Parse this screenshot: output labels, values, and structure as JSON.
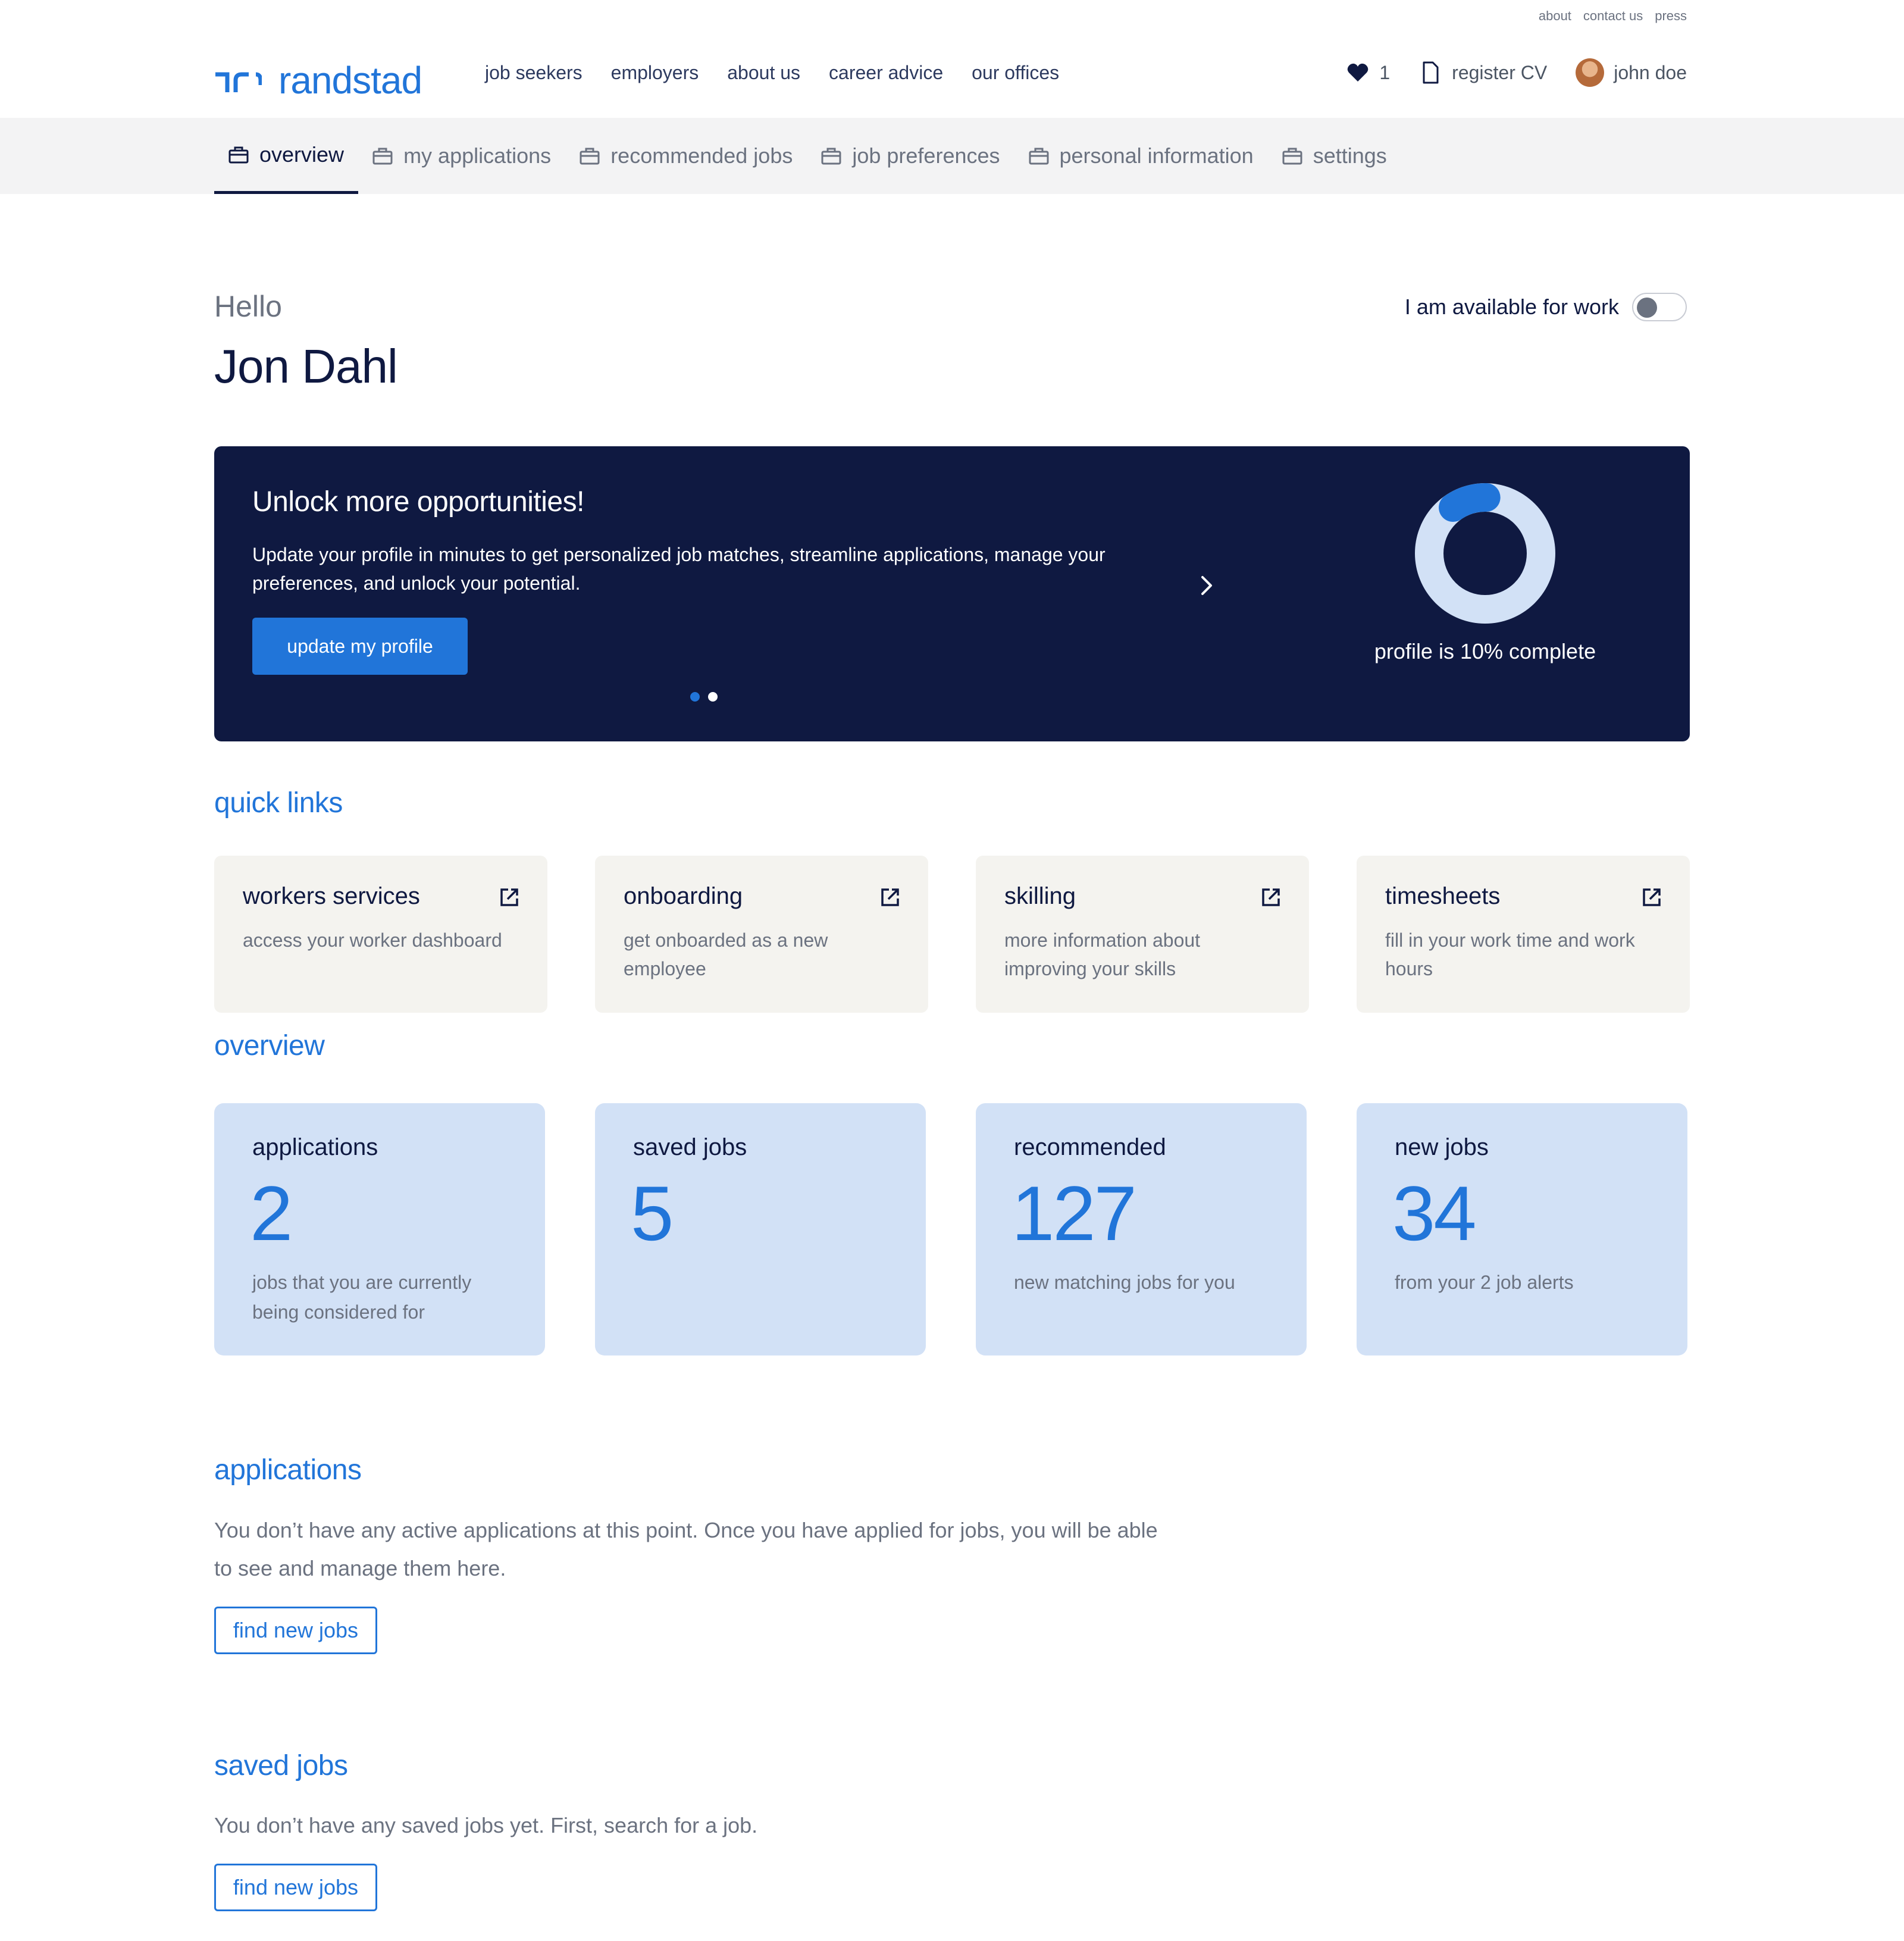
{
  "util_links": [
    "about",
    "contact us",
    "press"
  ],
  "header": {
    "logo_text": "randstad",
    "nav": [
      "job seekers",
      "employers",
      "about us",
      "career advice",
      "our offices"
    ],
    "favorites_count": "1",
    "register_cv": "register CV",
    "user_name": "john doe"
  },
  "sub_nav": {
    "tabs": [
      "overview",
      "my applications",
      "recommended jobs",
      "job preferences",
      "personal information",
      "settings"
    ],
    "active": "overview"
  },
  "greeting": {
    "hello": "Hello",
    "name": "Jon Dahl",
    "availability_label": "I am available for work",
    "availability_on": false
  },
  "banner": {
    "title": "Unlock more opportunities!",
    "description": "Update your profile in minutes to get personalized job matches, streamline applications, manage your preferences, and unlock your potential.",
    "button": "update my profile",
    "progress_label": "profile is 10% complete",
    "progress_fraction": 0.1,
    "carousel_pages": 2,
    "carousel_active": 0
  },
  "quick_links": {
    "title": "quick links",
    "items": [
      {
        "title": "workers services",
        "desc": "access your worker dashboard"
      },
      {
        "title": "onboarding",
        "desc": "get onboarded as a new employee"
      },
      {
        "title": "skilling",
        "desc": "more information about improving your skills"
      },
      {
        "title": "timesheets",
        "desc": "fill in your work time and work hours"
      }
    ]
  },
  "overview": {
    "title": "overview",
    "stats": [
      {
        "label": "applications",
        "value": "2",
        "desc": "jobs that you are currently being considered for"
      },
      {
        "label": "saved jobs",
        "value": "5",
        "desc": ""
      },
      {
        "label": "recommended",
        "value": "127",
        "desc": "new matching jobs for you"
      },
      {
        "label": "new jobs",
        "value": "34",
        "desc": "from your 2 job alerts"
      }
    ]
  },
  "applications": {
    "title": "applications",
    "text": "You don’t have any active applications at this point. Once you have applied for jobs, you will be able to see and manage them here.",
    "button": "find new jobs"
  },
  "saved_jobs": {
    "title": "saved jobs",
    "text": "You don’t have any saved jobs yet. First, search for a job.",
    "button": "find new jobs"
  },
  "colors": {
    "brand_blue": "#2175d9",
    "navy": "#0f1941",
    "stat_bg": "#d2e1f6",
    "quick_link_bg": "#f4f3ef",
    "ring_track": "#d2e1f6"
  }
}
